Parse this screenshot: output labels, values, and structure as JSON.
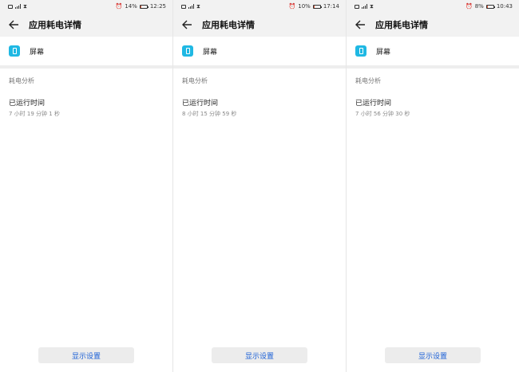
{
  "screens": [
    {
      "status": {
        "battery": "14%",
        "time": "12:25",
        "battery_level": 0.14
      },
      "app_bar": {
        "title": "应用耗电详情"
      },
      "app": {
        "name": "屏幕"
      },
      "section": {
        "label": "耗电分析"
      },
      "runtime": {
        "label": "已运行时间",
        "value": "7 小时 19 分钟 1 秒"
      },
      "button": {
        "label": "显示设置"
      }
    },
    {
      "status": {
        "battery": "10%",
        "time": "17:14",
        "battery_level": 0.1
      },
      "app_bar": {
        "title": "应用耗电详情"
      },
      "app": {
        "name": "屏幕"
      },
      "section": {
        "label": "耗电分析"
      },
      "runtime": {
        "label": "已运行时间",
        "value": "8 小时 15 分钟 59 秒"
      },
      "button": {
        "label": "显示设置"
      }
    },
    {
      "status": {
        "battery": "8%",
        "time": "10:43",
        "battery_level": 0.08
      },
      "app_bar": {
        "title": "应用耗电详情"
      },
      "app": {
        "name": "屏幕"
      },
      "section": {
        "label": "耗电分析"
      },
      "runtime": {
        "label": "已运行时间",
        "value": "7 小时 56 分钟 30 秒"
      },
      "button": {
        "label": "显示设置"
      }
    }
  ],
  "colors": {
    "accent": "#1a5fd6",
    "app_icon": "#1fb8e3",
    "battery_low": "#e25c3b"
  },
  "icons": {
    "back": "arrow-left-icon",
    "app": "phone-icon",
    "alarm": "alarm-clock-icon"
  }
}
